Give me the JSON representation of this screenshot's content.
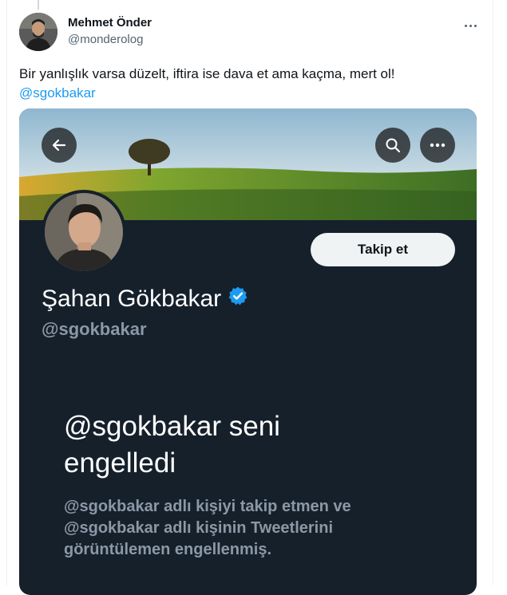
{
  "tweet": {
    "author_name": "Mehmet Önder",
    "author_handle": "@monderolog",
    "text": "Bir yanlışlık varsa düzelt, iftira ise dava et ama kaçma, mert ol!",
    "mention": "@sgokbakar",
    "more_icon": "more-horizontal-icon"
  },
  "profile_card": {
    "back_icon": "arrow-left-icon",
    "search_icon": "search-icon",
    "more_icon": "more-horizontal-icon",
    "follow_label": "Takip et",
    "name": "Şahan Gökbakar",
    "verified_icon": "verified-badge-icon",
    "handle": "@sgokbakar",
    "blocked_title": "@sgokbakar seni engelledi",
    "blocked_description": "@sgokbakar adlı kişiyi takip etmen ve @sgokbakar adlı kişinin Tweetlerini görüntülemen engellenmiş."
  },
  "colors": {
    "link": "#1d9bf0",
    "card_background": "#15202b",
    "verified": "#1d9bf0",
    "secondary_text": "#8b98a5"
  }
}
